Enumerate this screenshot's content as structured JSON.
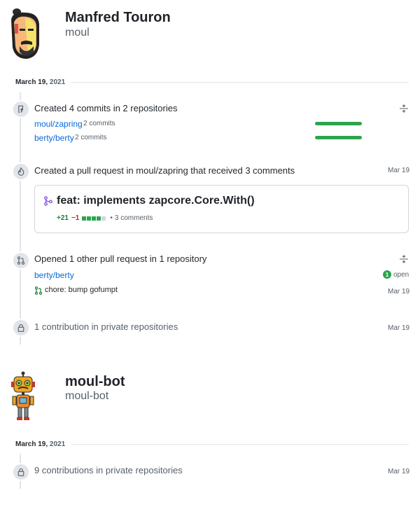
{
  "user1": {
    "name": "Manfred Touron",
    "handle": "moul",
    "date_month": "March 19,",
    "date_year": "2021",
    "commits": {
      "summary": "Created 4 commits in 2 repositories",
      "repos": [
        {
          "name": "moul/zapring",
          "count": "2 commits",
          "fill": 1.0
        },
        {
          "name": "berty/berty",
          "count": "2 commits",
          "fill": 1.0
        }
      ]
    },
    "pull_request": {
      "summary": "Created a pull request in moul/zapring that received 3 comments",
      "date": "Mar 19",
      "title": "feat: implements zapcore.Core.With()",
      "additions": "+21",
      "deletions": "−1",
      "diffstat": [
        "green",
        "green",
        "green",
        "green",
        "gray"
      ],
      "comments": "3 comments"
    },
    "other_pr": {
      "summary": "Opened 1 other pull request in 1 repository",
      "repo": "berty/berty",
      "open_count": "1",
      "open_label": "open",
      "title": "chore: bump gofumpt",
      "date": "Mar 19"
    },
    "private": {
      "summary": "1 contribution in private repositories",
      "date": "Mar 19"
    }
  },
  "user2": {
    "name": "moul-bot",
    "handle": "moul-bot",
    "date_month": "March 19,",
    "date_year": "2021",
    "private": {
      "summary": "9 contributions in private repositories",
      "date": "Mar 19"
    }
  },
  "icons": [
    "avatar",
    "repo-push-icon",
    "flame-icon",
    "git-pull-request-icon",
    "lock-icon",
    "fold-icon",
    "git-merge-icon"
  ],
  "colors": {
    "link": "#0969da",
    "green": "#2ea44f",
    "red": "#cf222e",
    "purple": "#8250df",
    "muted": "#57606a"
  }
}
